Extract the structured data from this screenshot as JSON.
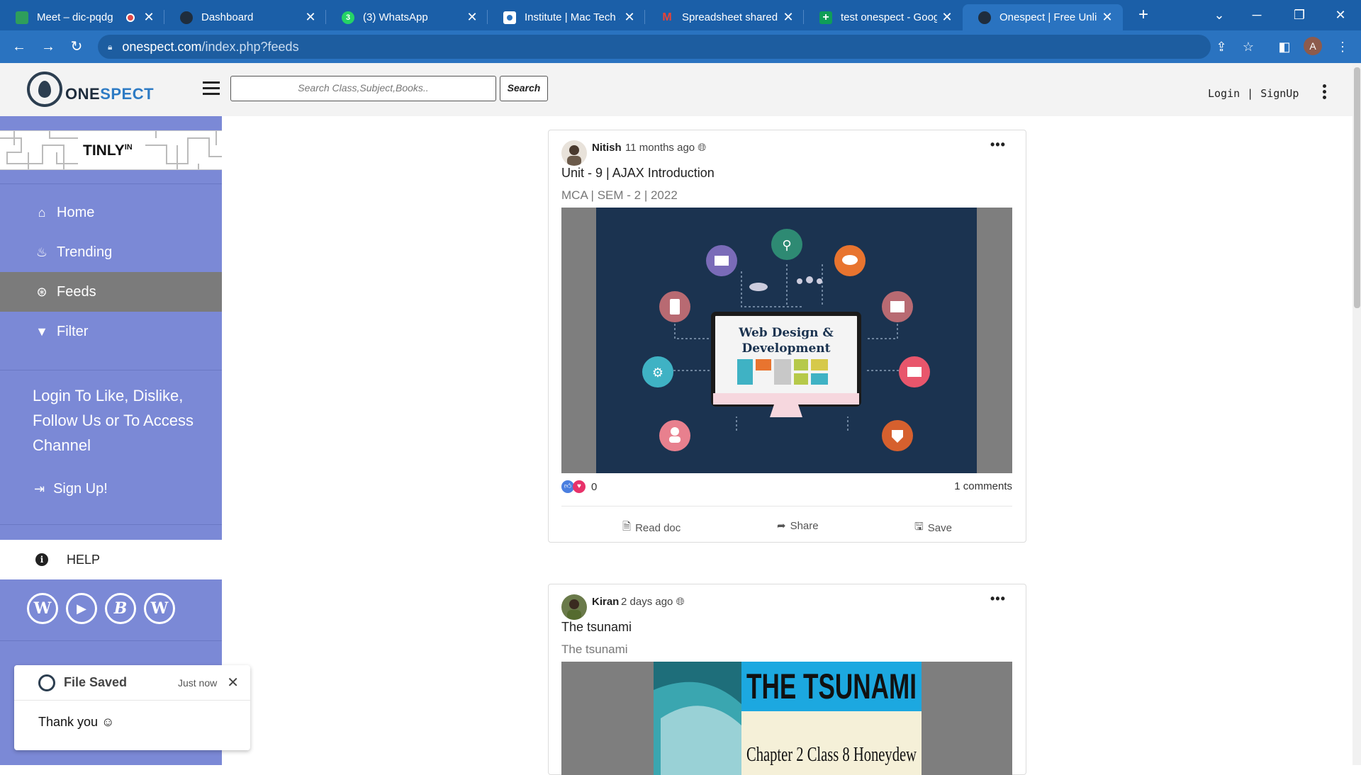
{
  "browser": {
    "tabs": [
      {
        "title": "Meet – dic-pqdg",
        "favicon_color": "#2e9e5b",
        "close": "✕"
      },
      {
        "title": "Dashboard",
        "favicon_color": "#1f2d3d",
        "close": "✕"
      },
      {
        "title": "(3) WhatsApp",
        "favicon_color": "#25d366",
        "close": "✕"
      },
      {
        "title": "Institute | Mac Tech S",
        "favicon_color": "#ffffff",
        "close": "✕"
      },
      {
        "title": "Spreadsheet shared w",
        "favicon_color": "#ffffff",
        "close": "✕"
      },
      {
        "title": "test onespect - Googl",
        "favicon_color": "#0f9d58",
        "close": "✕"
      },
      {
        "title": "Onespect | Free Unlim",
        "favicon_color": "#1f2d3d",
        "close": "✕"
      }
    ],
    "new_tab": "+",
    "url_domain": "onespect.com",
    "url_path": "/index.php?feeds",
    "profile_initial": "A"
  },
  "header": {
    "logo_text_one": "ONE",
    "logo_text_spect": "SPECT",
    "search_placeholder": "Search Class,Subject,Books..",
    "search_button": "Search",
    "login": "Login",
    "signup": "SignUp",
    "pipe": "|"
  },
  "sidebar": {
    "brand": "TINLY",
    "brand_sup": "IN",
    "items": [
      {
        "label": "Home",
        "icon": "home-icon",
        "glyph": "⌂"
      },
      {
        "label": "Trending",
        "icon": "fire-icon",
        "glyph": "♨"
      },
      {
        "label": "Feeds",
        "icon": "rss-icon",
        "glyph": "⊛"
      },
      {
        "label": "Filter",
        "icon": "filter-icon",
        "glyph": "▼"
      }
    ],
    "login_message": "Login To Like, Dislike, Follow Us or To Access Channel",
    "signup_label": "Sign Up!",
    "help_label": "HELP",
    "socials": [
      {
        "name": "wikipedia-icon",
        "glyph": "W"
      },
      {
        "name": "youtube-icon",
        "glyph": "▶"
      },
      {
        "name": "blogger-icon",
        "glyph": "B"
      },
      {
        "name": "wordpress-icon",
        "glyph": "W"
      }
    ]
  },
  "toast": {
    "title": "File Saved",
    "time": "Just now",
    "message": "Thank you ☺"
  },
  "posts": [
    {
      "author": "Nitish",
      "time": "11 months ago",
      "title": "Unit - 9 | AJAX Introduction",
      "subtitle": "MCA | SEM - 2 | 2022",
      "image_text_line1": "Web Design &",
      "image_text_line2": "Development",
      "like_count": "0",
      "comments": "1 comments",
      "actions": {
        "read": "Read doc",
        "share": "Share",
        "save": "Save"
      }
    },
    {
      "author": "Kiran",
      "time": "2 days ago",
      "title": "The tsunami",
      "subtitle": "The tsunami",
      "image_text_line1": "THE TSUNAMI",
      "image_text_line2": "Chapter 2 Class 8 Honeydew"
    }
  ],
  "colors": {
    "chrome_tabbar": "#1b5fa8",
    "chrome_active": "#2a73c0",
    "sidebar": "#7b89d6",
    "sidebar_active": "#7b7b7b",
    "brand_blue": "#2e7bc4"
  }
}
